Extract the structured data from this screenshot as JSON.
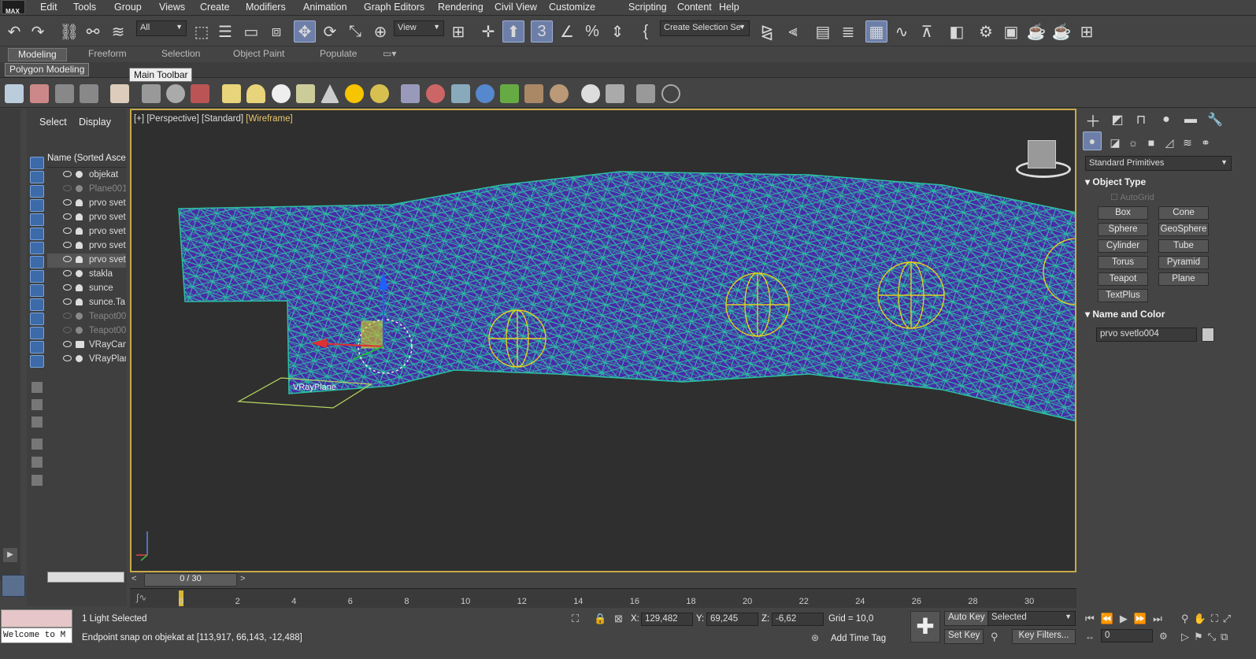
{
  "menu": {
    "logo": "MAX",
    "items": [
      "Edit",
      "Tools",
      "Group",
      "Views",
      "Create",
      "Modifiers",
      "Animation",
      "Graph Editors",
      "Rendering",
      "Civil View",
      "Customize",
      "Scripting",
      "Content",
      "Help"
    ]
  },
  "main_toolbar": {
    "selection_filter": "All",
    "ref_coord": "View",
    "named_selection": "Create Selection Se"
  },
  "ribbon": {
    "tabs": [
      "Modeling",
      "Freeform",
      "Selection",
      "Object Paint",
      "Populate"
    ],
    "active_tab": "Modeling",
    "panel_label": "Polygon Modeling",
    "tooltip": "Main Toolbar"
  },
  "scene_explorer": {
    "tabs": [
      "Select",
      "Display"
    ],
    "column_header": "Name (Sorted Ascer",
    "rows": [
      {
        "name": "objekat",
        "type": "geo",
        "hidden": false,
        "selected": false
      },
      {
        "name": "Plane001",
        "type": "geo",
        "hidden": true,
        "selected": false
      },
      {
        "name": "prvo svet",
        "type": "light",
        "hidden": false,
        "selected": false
      },
      {
        "name": "prvo svet",
        "type": "light",
        "hidden": false,
        "selected": false
      },
      {
        "name": "prvo svet",
        "type": "light",
        "hidden": false,
        "selected": false
      },
      {
        "name": "prvo svet",
        "type": "light",
        "hidden": false,
        "selected": false
      },
      {
        "name": "prvo svet",
        "type": "light",
        "hidden": false,
        "selected": true
      },
      {
        "name": "stakla",
        "type": "geo",
        "hidden": false,
        "selected": false
      },
      {
        "name": "sunce",
        "type": "light",
        "hidden": false,
        "selected": false
      },
      {
        "name": "sunce.Ta",
        "type": "light",
        "hidden": false,
        "selected": false
      },
      {
        "name": "Teapot00",
        "type": "geo",
        "hidden": true,
        "selected": false
      },
      {
        "name": "Teapot00",
        "type": "geo",
        "hidden": true,
        "selected": false
      },
      {
        "name": "VRayCam",
        "type": "camera",
        "hidden": false,
        "selected": false
      },
      {
        "name": "VRayPlan",
        "type": "geo",
        "hidden": false,
        "selected": false
      }
    ]
  },
  "viewport": {
    "label_parts": [
      "[+]",
      "[Perspective]",
      "[Standard]",
      "[Wireframe]"
    ],
    "object_label": "VRayPlane",
    "wire_color": "#2bc0a0",
    "poly_color": "#5a2ab0",
    "light_color": "#e0d020"
  },
  "command_panel": {
    "category": "Standard Primitives",
    "object_type_title": "Object Type",
    "autogrid": "AutoGrid",
    "buttons": [
      "Box",
      "Cone",
      "Sphere",
      "GeoSphere",
      "Cylinder",
      "Tube",
      "Torus",
      "Pyramid",
      "Teapot",
      "Plane",
      "TextPlus"
    ],
    "name_color_title": "Name and Color",
    "object_name": "prvo svetlo004",
    "object_color": "#c8c8c8"
  },
  "timeline": {
    "frame_display": "0 / 30",
    "ticks": [
      "0",
      "2",
      "4",
      "6",
      "8",
      "10",
      "12",
      "14",
      "16",
      "18",
      "20",
      "22",
      "24",
      "26",
      "28",
      "30"
    ]
  },
  "status": {
    "maxscript": "Welcome to M",
    "selection": "1 Light Selected",
    "prompt": "Endpoint snap on objekat at [113,917, 66,143, -12,488]",
    "x_label": "X:",
    "x": "129,482",
    "y_label": "Y:",
    "y": "69,245",
    "z_label": "Z:",
    "z": "-6,62",
    "grid": "Grid = 10,0",
    "add_time_tag": "Add Time Tag",
    "auto_key": "Auto Key",
    "set_key": "Set Key",
    "key_mode": "Selected",
    "key_filters": "Key Filters...",
    "frame": "0"
  }
}
